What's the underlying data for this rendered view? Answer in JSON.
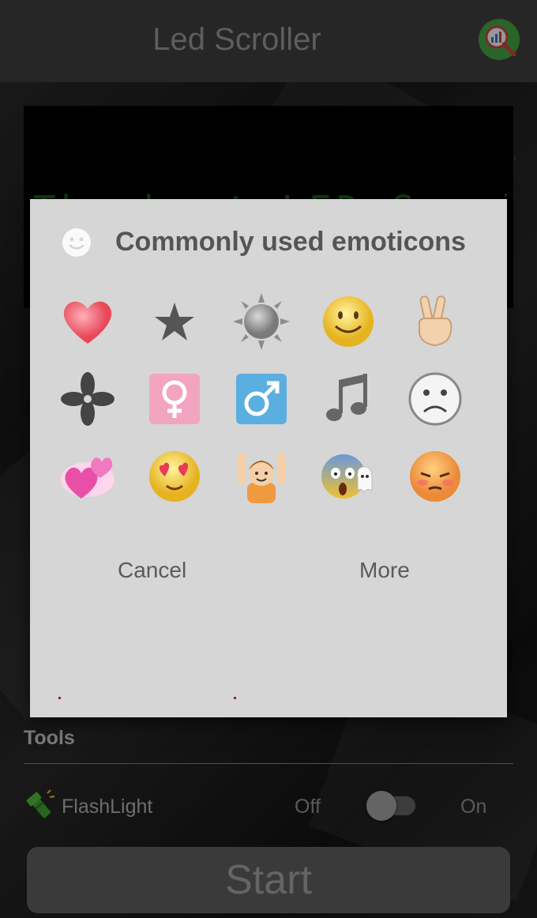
{
  "app": {
    "title": "Led Scroller",
    "led_text": "The best LED Scroller !!",
    "tools_label": "Tools",
    "flashlight_label": "FlashLight",
    "flashlight_off": "Off",
    "flashlight_on": "On",
    "flashlight_state": false,
    "start_label": "Start"
  },
  "dialog": {
    "title": "Commonly used emoticons",
    "cancel_label": "Cancel",
    "more_label": "More",
    "emoticons": [
      "heart",
      "star",
      "sun",
      "smiling-face",
      "victory-hand",
      "four-petal-flower",
      "female-sign",
      "male-sign",
      "musical-notes",
      "frowning-face",
      "two-hearts",
      "heart-eyes-face",
      "raised-hands-person",
      "screaming-face-ghost",
      "pouting-face"
    ]
  },
  "colors": {
    "dialog_bg": "#d6d6d6",
    "led_green": "#1d5f1d",
    "appbar_bg": "#3b3b3b"
  }
}
